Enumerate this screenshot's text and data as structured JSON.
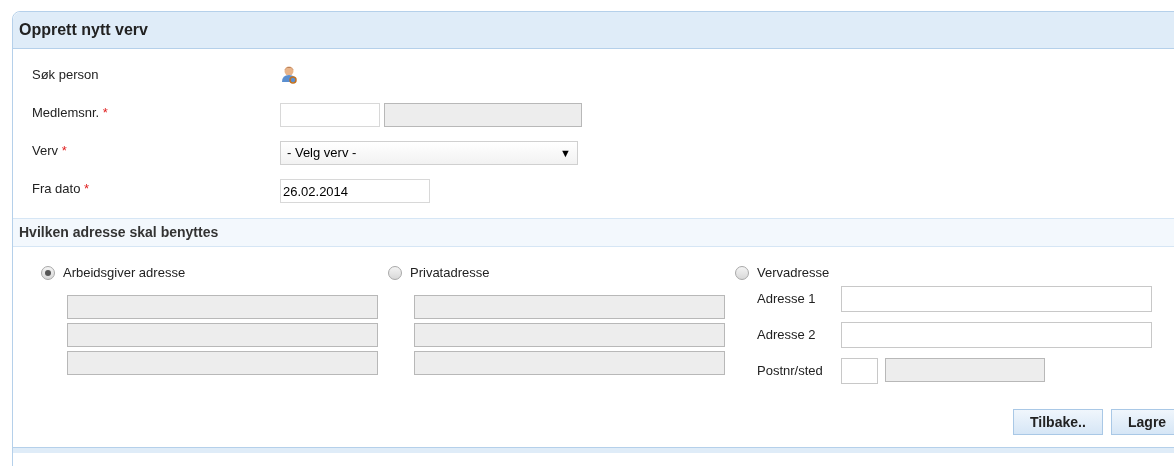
{
  "panel": {
    "title": "Opprett nytt verv"
  },
  "fields": [
    {
      "kind": "search",
      "label": "Søk person",
      "required": false
    },
    {
      "kind": "member",
      "label": "Medlemsnr.",
      "required": true,
      "inputs": [
        {
          "disabled": false
        },
        {
          "disabled": true
        }
      ]
    },
    {
      "kind": "select",
      "label": "Verv",
      "required": true,
      "value": "- Velg verv -",
      "arrow": "▼"
    },
    {
      "kind": "date",
      "label": "Fra dato",
      "required": true,
      "value": "26.02.2014"
    }
  ],
  "required_mark": "*",
  "address_section": {
    "title": "Hvilken adresse skal benyttes",
    "options": [
      {
        "label": "Arbeidsgiver adresse",
        "selected": true,
        "lines": [
          {
            "disabled": true
          },
          {
            "disabled": true
          },
          {
            "disabled": true
          }
        ]
      },
      {
        "label": "Privatadresse",
        "selected": false,
        "lines": [
          {
            "disabled": true
          },
          {
            "disabled": true
          },
          {
            "disabled": true
          }
        ]
      },
      {
        "label": "Vervadresse",
        "selected": false,
        "lines": [
          {
            "label": "Adresse 1",
            "disabled": false
          },
          {
            "label": "Adresse 2",
            "disabled": false
          },
          {
            "label": "Postnr/sted",
            "disabled": false,
            "kind": "postal"
          }
        ]
      }
    ]
  },
  "buttons": [
    "Tilbake..",
    "Lagre"
  ]
}
